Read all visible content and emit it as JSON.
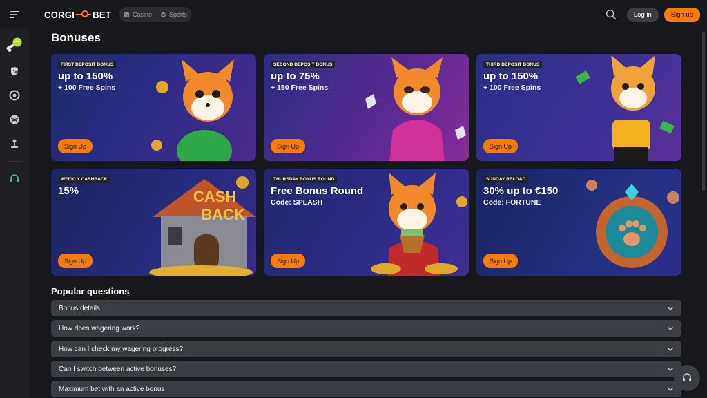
{
  "brand": {
    "name_left": "CORGI",
    "name_right": "BET"
  },
  "modes": [
    {
      "label": "Casino",
      "icon": "dice-icon"
    },
    {
      "label": "Sports",
      "icon": "ball-icon"
    }
  ],
  "header": {
    "login_label": "Log in",
    "signup_label": "Sign up"
  },
  "page": {
    "title": "Bonuses"
  },
  "bonuses": [
    {
      "tag": "FIRST DEPOSIT BONUS",
      "headline": "up to 150%",
      "sub": "+ 100 Free Spins",
      "cta": "Sign Up"
    },
    {
      "tag": "SECOND DEPOSIT BONUS",
      "headline": "up to 75%",
      "sub": "+ 150 Free Spins",
      "cta": "Sign Up"
    },
    {
      "tag": "THIRD DEPOSIT BONUS",
      "headline": "up to 150%",
      "sub": "+ 100 Free Spins",
      "cta": "Sign Up"
    },
    {
      "tag": "WEEKLY CASHBACK",
      "headline": "15%",
      "sub": "",
      "cta": "Sign Up",
      "art_text_1": "CASH",
      "art_text_2": "BACK"
    },
    {
      "tag": "THURSDAY BONUS ROUND",
      "headline": "Free Bonus Round",
      "sub": "Code: SPLASH",
      "cta": "Sign Up"
    },
    {
      "tag": "SUNDAY RELOAD",
      "headline": "30% up to €150",
      "sub": "Code: FORTUNE",
      "cta": "Sign Up"
    }
  ],
  "faq": {
    "title": "Popular questions",
    "items": [
      "Bonus details",
      "How does wagering work?",
      "How can I check my wagering progress?",
      "Can I switch between active bonuses?",
      "Maximum bet with an active bonus"
    ]
  },
  "colors": {
    "accent": "#ff7a00",
    "bg": "#17181c",
    "sidebar": "#1f2025",
    "faq_row": "#3b3d45",
    "support_green": "#2ecc71"
  }
}
